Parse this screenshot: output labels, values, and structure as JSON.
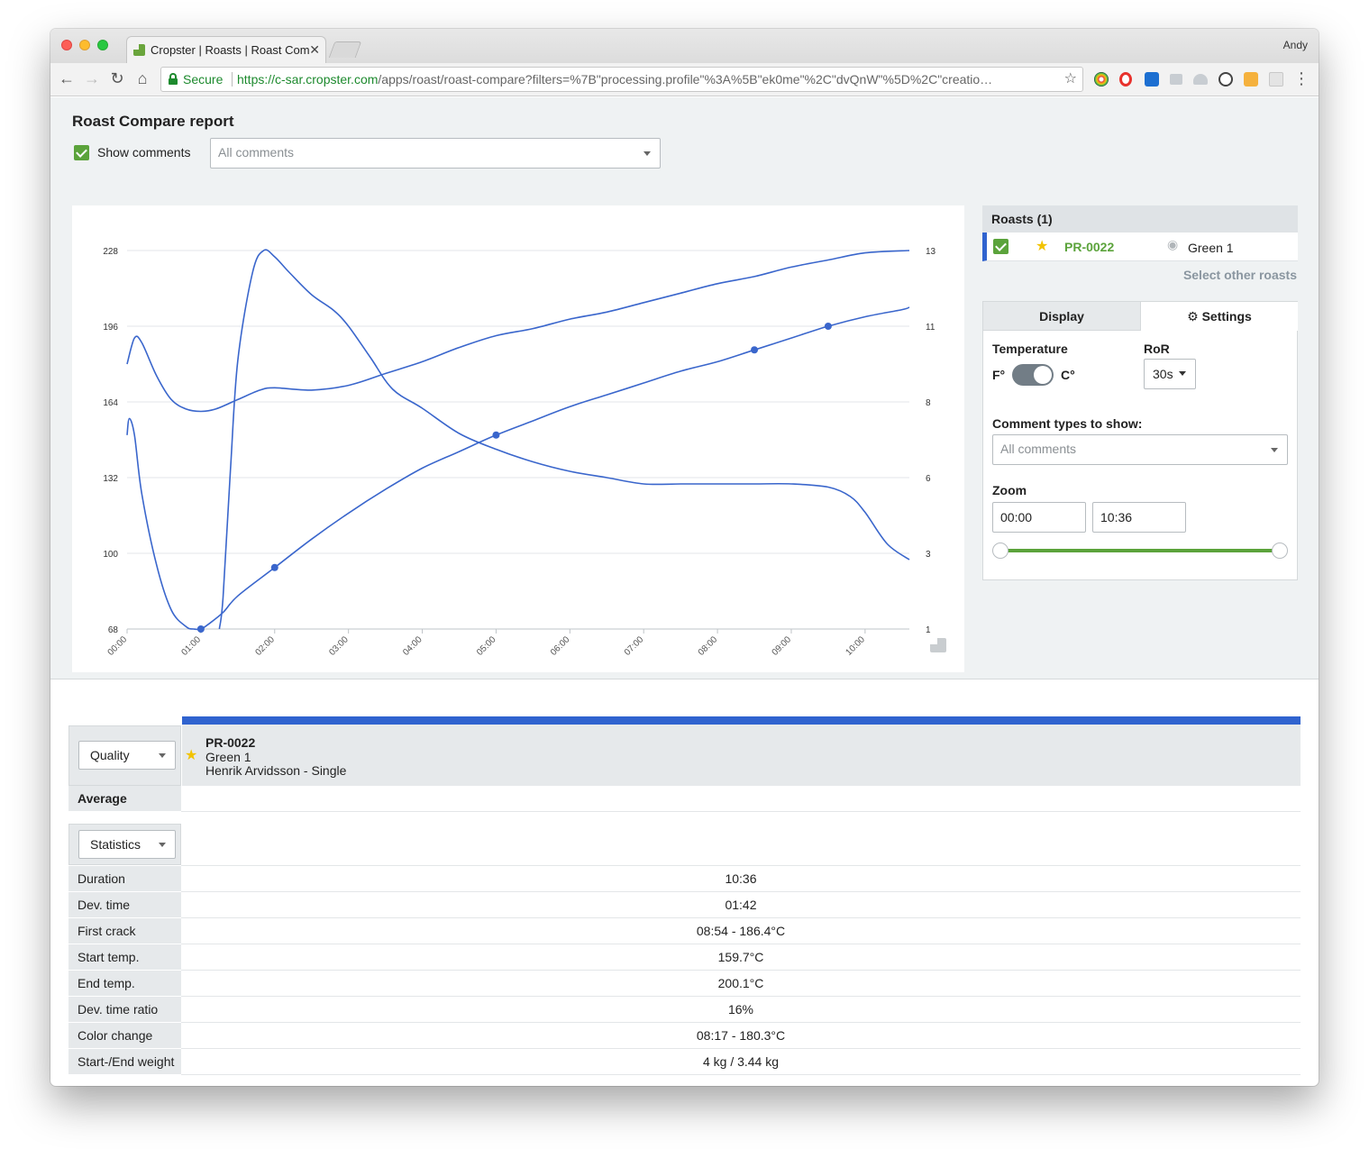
{
  "browser": {
    "tab_title": "Cropster | Roasts | Roast Com",
    "tab_close": "✕",
    "profile_name": "Andy",
    "secure_label": "Secure",
    "url_host": "https://c-sar.cropster.com",
    "url_path": "/apps/roast/roast-compare?filters=%7B\"processing.profile\"%3A%5B\"ek0me\"%2C\"dvQnW\"%5D%2C\"creatio…",
    "back_icon": "←",
    "forward_icon": "→",
    "reload_icon": "↻",
    "home_icon": "⌂",
    "star_icon": "☆",
    "menu_icon": "⋮"
  },
  "report": {
    "title": "Roast Compare report",
    "show_comments_label": "Show comments",
    "comments_filter_placeholder": "All comments"
  },
  "roasts": {
    "header": "Roasts (1)",
    "items": [
      {
        "code": "PR-0022",
        "name": "Green 1",
        "starred": true,
        "checked": true
      }
    ],
    "select_other": "Select other roasts"
  },
  "settings": {
    "tab_display": "Display",
    "tab_settings": "⚙ Settings",
    "temperature_label": "Temperature",
    "unit_f": "F°",
    "unit_c": "C°",
    "ror_label": "RoR",
    "ror_value": "30s",
    "comment_types_label": "Comment types to show:",
    "comment_types_value": "All comments",
    "zoom_label": "Zoom",
    "zoom_start": "00:00",
    "zoom_end": "10:36",
    "accent_color": "#5ba33b"
  },
  "chart_data": {
    "type": "line",
    "x_unit": "minutes",
    "x_ticks": [
      "00:00",
      "01:00",
      "02:00",
      "03:00",
      "04:00",
      "05:00",
      "06:00",
      "07:00",
      "08:00",
      "09:00",
      "10:00"
    ],
    "xlim": [
      0,
      10.6
    ],
    "y_left_ticks": [
      68,
      100,
      132,
      164,
      196,
      228
    ],
    "ylim_left": [
      68,
      228
    ],
    "y_right_ticks": [
      1,
      3,
      6,
      8,
      11,
      13
    ],
    "ylim_right": [
      1,
      13
    ],
    "line_color": "#3a66cc",
    "series": [
      {
        "axis": "left",
        "x": [
          0.0,
          0.03,
          0.1,
          0.2,
          0.4,
          0.6,
          0.8,
          0.9,
          1.0,
          1.1,
          1.3,
          1.5,
          2.0,
          2.5,
          3.0,
          3.5,
          4.0,
          4.5,
          5.0,
          5.5,
          6.0,
          6.5,
          7.0,
          7.5,
          8.0,
          8.5,
          9.0,
          9.5,
          10.0,
          10.5,
          10.6
        ],
        "y": [
          150,
          157,
          150,
          125,
          95,
          76,
          69,
          68,
          68,
          70,
          75,
          82,
          94,
          106,
          117,
          127,
          136,
          143,
          150,
          156,
          162,
          167,
          172,
          177,
          181,
          186,
          191,
          196,
          200,
          203,
          204
        ]
      },
      {
        "axis": "left",
        "x": [
          0.0,
          0.1,
          0.2,
          0.4,
          0.6,
          0.8,
          1.0,
          1.2,
          1.5,
          1.8,
          2.0,
          2.5,
          3.0,
          3.5,
          4.0,
          4.5,
          5.0,
          5.5,
          6.0,
          6.5,
          7.0,
          7.5,
          8.0,
          8.5,
          9.0,
          9.5,
          10.0,
          10.6
        ],
        "y": [
          180,
          191,
          189,
          175,
          165,
          161,
          160,
          161,
          165,
          169,
          170,
          169,
          171,
          176,
          181,
          187,
          192,
          195,
          199,
          202,
          206,
          210,
          214,
          217,
          221,
          224,
          227,
          228
        ]
      },
      {
        "axis": "right",
        "x": [
          1.25,
          1.3,
          1.4,
          1.5,
          1.7,
          1.85,
          2.0,
          2.2,
          2.5,
          2.8,
          3.0,
          3.3,
          3.6,
          4.0,
          4.5,
          5.0,
          5.5,
          6.0,
          6.5,
          7.0,
          7.5,
          8.0,
          8.5,
          9.0,
          9.5,
          9.8,
          10.0,
          10.3,
          10.6
        ],
        "y": [
          1.0,
          2.0,
          6.0,
          9.5,
          12.3,
          13.0,
          12.8,
          12.3,
          11.6,
          11.1,
          10.6,
          9.6,
          8.6,
          8.0,
          7.2,
          6.7,
          6.3,
          6.0,
          5.8,
          5.6,
          5.6,
          5.6,
          5.6,
          5.6,
          5.5,
          5.2,
          4.7,
          3.7,
          3.2
        ]
      }
    ]
  },
  "table": {
    "roast": {
      "code": "PR-0022",
      "name": "Green 1",
      "owner": "Henrik Arvidsson - Single"
    },
    "quality_dropdown": "Quality",
    "average_label": "Average",
    "statistics_dropdown": "Statistics",
    "rows": [
      {
        "label": "Duration",
        "value": "10:36"
      },
      {
        "label": "Dev. time",
        "value": "01:42"
      },
      {
        "label": "First crack",
        "value": "08:54 - 186.4°C"
      },
      {
        "label": "Start temp.",
        "value": "159.7°C"
      },
      {
        "label": "End temp.",
        "value": "200.1°C"
      },
      {
        "label": "Dev. time ratio",
        "value": "16%"
      },
      {
        "label": "Color change",
        "value": "08:17 - 180.3°C"
      },
      {
        "label": "Start-/End weight",
        "value": "4 kg / 3.44 kg"
      }
    ]
  }
}
